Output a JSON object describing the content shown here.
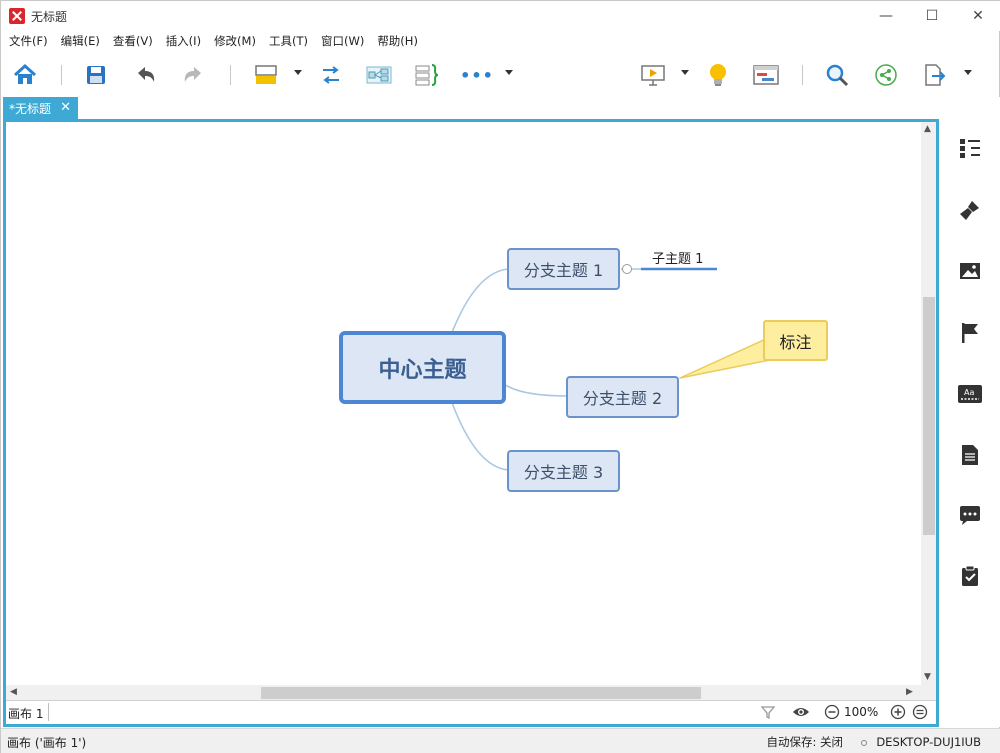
{
  "window": {
    "title": "无标题",
    "controls": {
      "minimize": "—",
      "maximize": "☐",
      "close": "✕"
    }
  },
  "menu": [
    "文件(F)",
    "编辑(E)",
    "查看(V)",
    "插入(I)",
    "修改(M)",
    "工具(T)",
    "窗口(W)",
    "帮助(H)"
  ],
  "toolbar": {
    "icons": [
      "home-icon",
      "save-icon",
      "undo-icon",
      "redo-icon",
      "topic-style-icon",
      "relationship-icon",
      "summary-icon",
      "boundary-icon",
      "more-icon",
      "presentation-icon",
      "idea-icon",
      "gantt-icon",
      "search-icon",
      "share-icon",
      "export-icon"
    ],
    "more_label": "•••"
  },
  "tab": {
    "label": "*无标题",
    "close": "✕"
  },
  "mindmap": {
    "central": "中心主题",
    "branches": [
      "分支主题 1",
      "分支主题 2",
      "分支主题 3"
    ],
    "subtopic": "子主题 1",
    "callout": "标注",
    "colors": {
      "topic_fill": "#dce6f4",
      "topic_border": "#6a93cc",
      "central_border": "#4d86d2",
      "connector": "#a9c8e4",
      "callout_fill": "#fdeea0",
      "callout_border": "#eccb5a",
      "subtopic_line": "#4d86d2"
    }
  },
  "sheet": {
    "name": "画布 1",
    "zoom": "100%"
  },
  "sidebar": [
    "outline-icon",
    "format-brush-icon",
    "image-icon",
    "flag-icon",
    "font-icon",
    "notes-icon",
    "comment-icon",
    "task-icon"
  ],
  "status": {
    "left": "画布 ('画布 1')",
    "autosave": "自动保存: 关闭",
    "computer": "DESKTOP-DUJ1IUB"
  },
  "accent": "#3fa9d5"
}
